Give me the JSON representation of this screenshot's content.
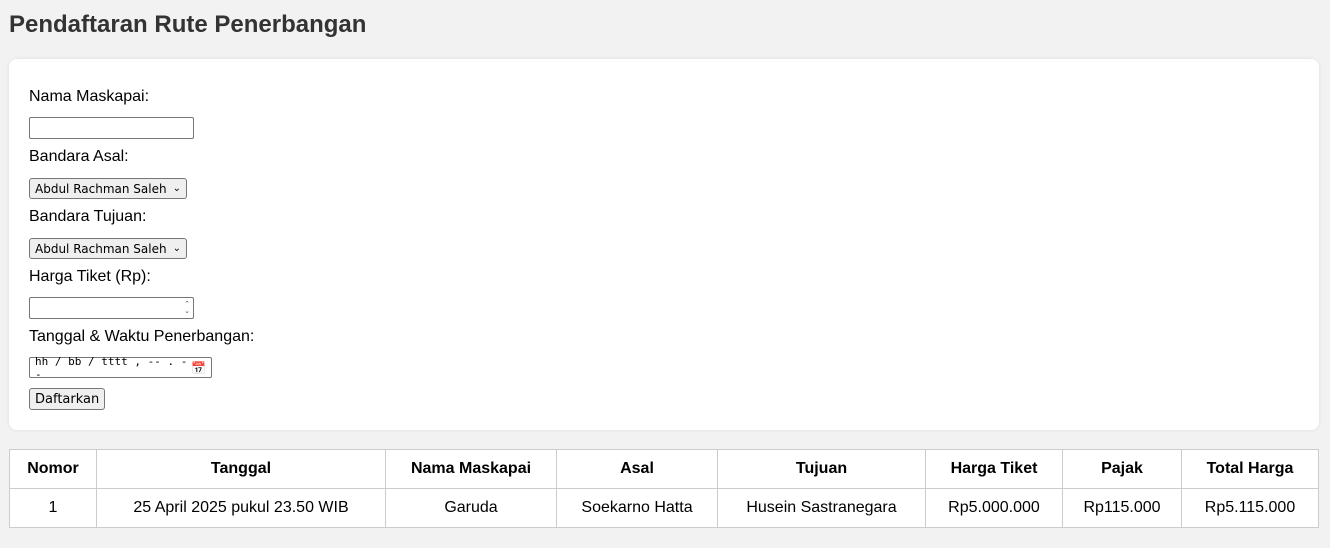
{
  "page": {
    "title": "Pendaftaran Rute Penerbangan"
  },
  "form": {
    "airline_label": "Nama Maskapai:",
    "airline_value": "",
    "origin_label": "Bandara Asal:",
    "origin_selected": "Abdul Rachman Saleh",
    "destination_label": "Bandara Tujuan:",
    "destination_selected": "Abdul Rachman Saleh",
    "price_label": "Harga Tiket (Rp):",
    "price_value": "",
    "datetime_label": "Tanggal & Waktu Penerbangan:",
    "datetime_placeholder": "hh / bb / tttt ,  -- . --",
    "submit_label": "Daftarkan"
  },
  "table": {
    "headers": [
      "Nomor",
      "Tanggal",
      "Nama Maskapai",
      "Asal",
      "Tujuan",
      "Harga Tiket",
      "Pajak",
      "Total Harga"
    ],
    "rows": [
      [
        "1",
        "25 April 2025 pukul 23.50 WIB",
        "Garuda",
        "Soekarno Hatta",
        "Husein Sastranegara",
        "Rp5.000.000",
        "Rp115.000",
        "Rp5.115.000"
      ]
    ]
  },
  "icons": {
    "chevron": "chevron-down-icon",
    "calendar": "calendar-icon",
    "spinner": "spinner-icon"
  }
}
